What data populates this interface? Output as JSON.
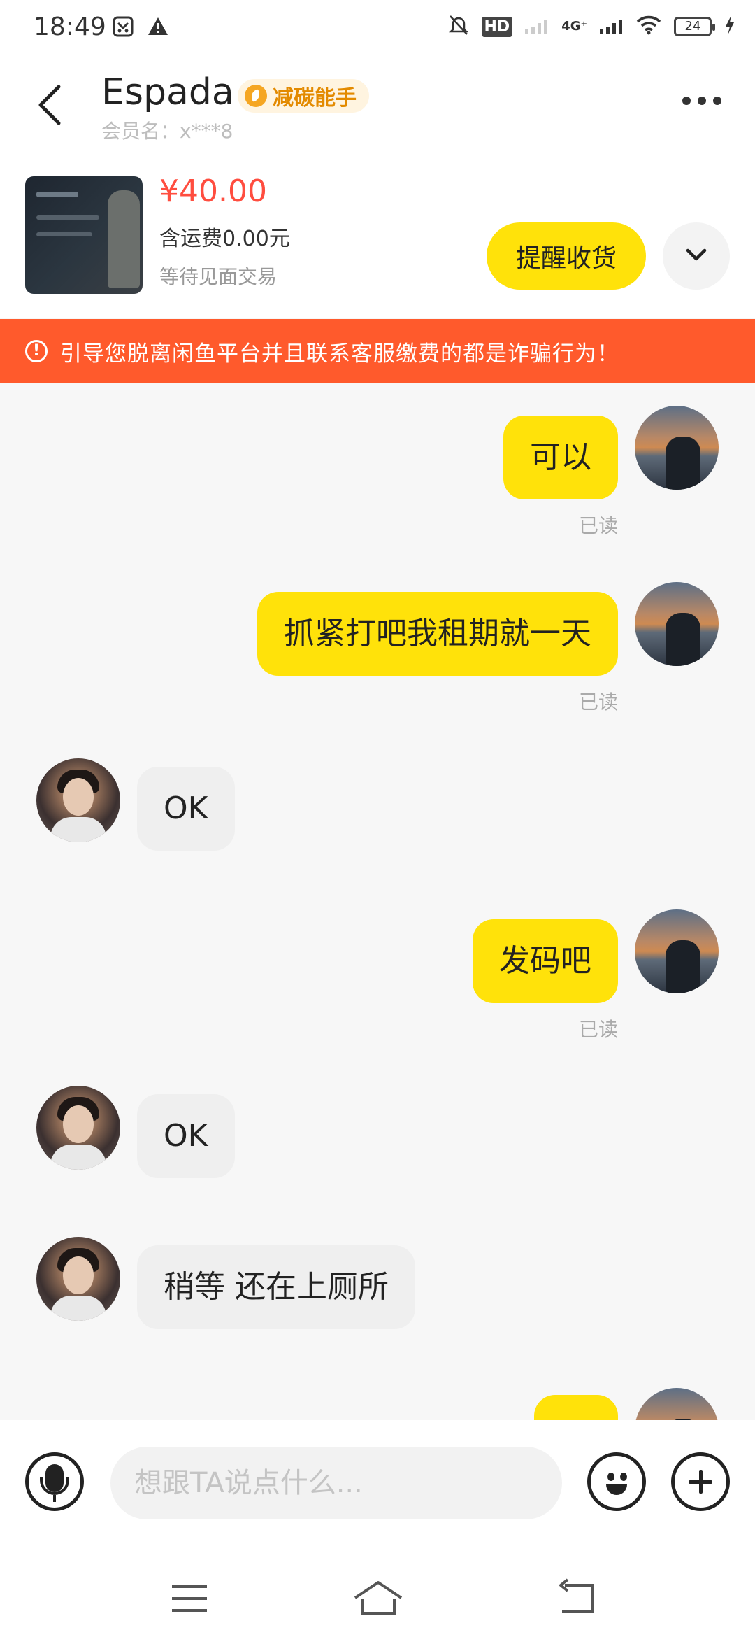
{
  "status_bar": {
    "time": "18:49",
    "hd_label": "HD",
    "network_label": "4G⁺",
    "battery": "24"
  },
  "header": {
    "title": "Espada",
    "badge_label": "减碳能手",
    "member": "会员名：x***8"
  },
  "product": {
    "price": "¥40.00",
    "shipping": "含运费0.00元",
    "status": "等待见面交易",
    "remind_button": "提醒收货"
  },
  "warning": {
    "text": "引导您脱离闲鱼平台并且联系客服缴费的都是诈骗行为！"
  },
  "messages": [
    {
      "from": "me",
      "text": "可以",
      "read": "已读"
    },
    {
      "from": "me",
      "text": "抓紧打吧我租期就一天",
      "read": "已读"
    },
    {
      "from": "them",
      "text": "OK"
    },
    {
      "from": "me",
      "text": "发码吧",
      "read": "已读"
    },
    {
      "from": "them",
      "text": "OK"
    },
    {
      "from": "them",
      "text": "稍等 还在上厕所"
    }
  ],
  "input": {
    "placeholder": "想跟TA说点什么..."
  },
  "colors": {
    "accent_yellow": "#ffe20a",
    "warning_orange": "#ff5a2c",
    "price_red": "#ff4d3f"
  }
}
